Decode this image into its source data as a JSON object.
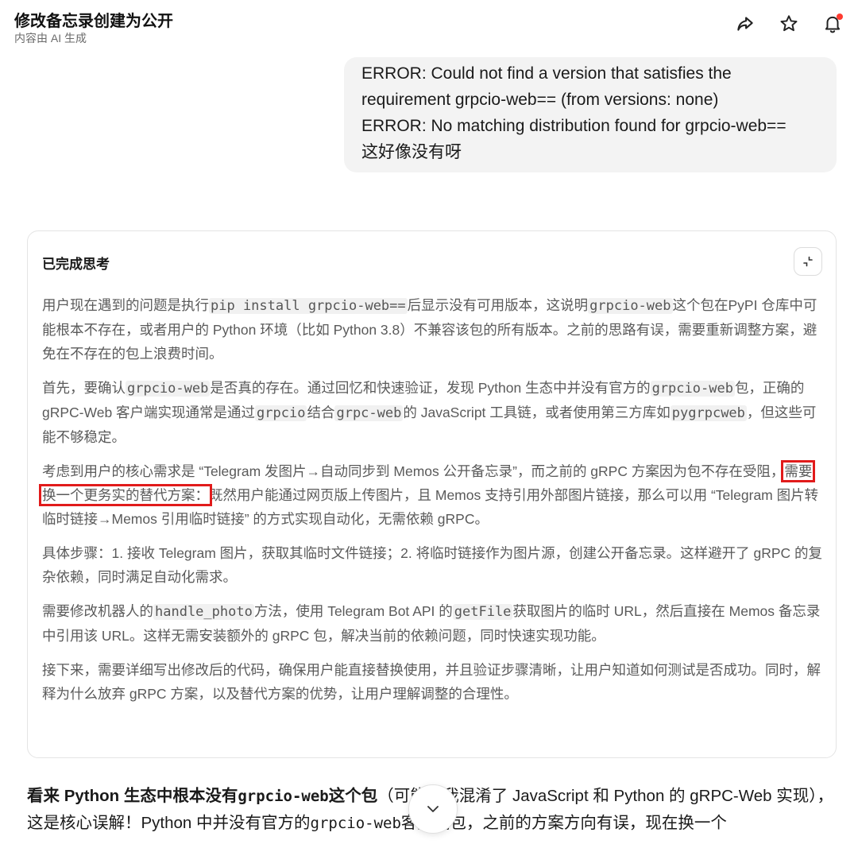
{
  "header": {
    "title": "修改备忘录创建为公开",
    "subtitle": "内容由 AI 生成"
  },
  "icons": {
    "share": "share-arrow-icon",
    "star": "star-icon",
    "bell": "bell-icon",
    "collapse": "collapse-icon",
    "scroll_down": "chevron-down-icon"
  },
  "colors": {
    "notification_dot": "#ff3b30",
    "highlight_box": "#e11b1b",
    "bubble_bg": "#f3f3f3"
  },
  "user_message": {
    "lines": [
      "ERROR: Could not find a version that satisfies the",
      "requirement grpcio-web== (from versions: none)",
      "ERROR: No matching distribution found for grpcio-web==",
      "这好像没有呀"
    ]
  },
  "thinking": {
    "title": "已完成思考",
    "p1": {
      "a": "用户现在遇到的问题是执行",
      "code1": "pip install grpcio-web==",
      "b": "后显示没有可用版本，这说明",
      "code2": "grpcio-web",
      "c": "这个包在PyPI 仓库中可能根本不存在，或者用户的 Python 环境（比如 Python 3.8）不兼容该包的所有版本。之前的思路有误，需要重新调整方案，避免在不存在的包上浪费时间。"
    },
    "p2": {
      "a": "首先，要确认",
      "code1": "grpcio-web",
      "b": "是否真的存在。通过回忆和快速验证，发现 Python 生态中并没有官方的",
      "code2": "grpcio-web",
      "c": "包，正确的 gRPC-Web 客户端实现通常是通过",
      "code3": "grpcio",
      "d": "结合",
      "code4": "grpc-web",
      "e": "的 JavaScript 工具链，或者使用第三方库如",
      "code5": "pygrpcweb",
      "f": "，但这些可能不够稳定。"
    },
    "p3": {
      "a": "考虑到用户的核心需求是 “Telegram 发图片→自动同步到 Memos 公开备忘录”，而之前的 gRPC 方案因为包不存在受阻，",
      "highlight": "需要换一个更务实的替代方案：",
      "b": "既然用户能通过网页版上传图片，且 Memos 支持引用外部图片链接，那么可以用 “Telegram 图片转临时链接→Memos 引用临时链接” 的方式实现自动化，无需依赖 gRPC。"
    },
    "p4": "具体步骤：1. 接收 Telegram 图片，获取其临时文件链接；2. 将临时链接作为图片源，创建公开备忘录。这样避开了 gRPC 的复杂依赖，同时满足自动化需求。",
    "p5": {
      "a": "需要修改机器人的",
      "code1": "handle_photo",
      "b": "方法，使用 Telegram Bot API 的",
      "code2": "getFile",
      "c": "获取图片的临时 URL，然后直接在 Memos 备忘录中引用该 URL。这样无需安装额外的 gRPC 包，解决当前的依赖问题，同时快速实现功能。"
    },
    "p6": "接下来，需要详细写出修改后的代码，确保用户能直接替换使用，并且验证步骤清晰，让用户知道如何测试是否成功。同时，解释为什么放弃 gRPC 方案，以及替代方案的优势，让用户理解调整的合理性。"
  },
  "answer": {
    "bold_a": "看来 Python 生态中根本没有",
    "bold_code": "grpcio-web",
    "bold_b": "这个包",
    "a": "（可能是我混淆了 JavaScript 和 Python 的 gRPC-Web 实现），这是核心误解！Python 中并没有官方的",
    "code1": "grpcio-web",
    "b": "客户端包，之前的方案方向有误，现在换一个"
  }
}
